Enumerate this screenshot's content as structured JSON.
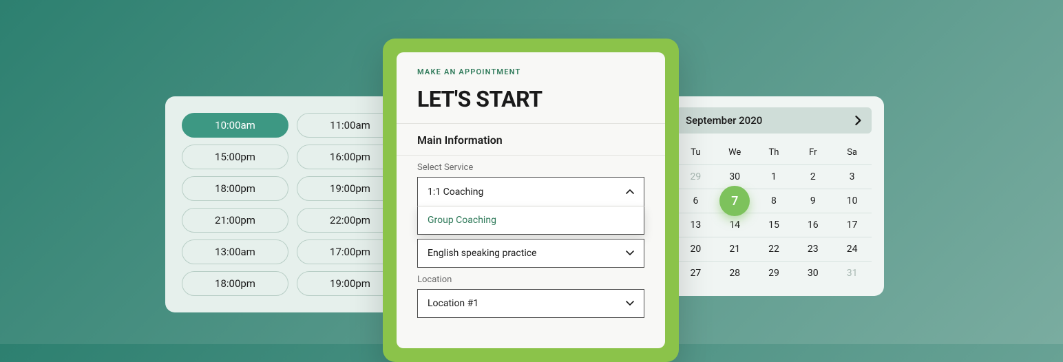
{
  "timeslots": {
    "items": [
      {
        "label": "10:00am",
        "selected": true
      },
      {
        "label": "11:00am",
        "selected": false
      },
      {
        "label": "15:00pm",
        "selected": false
      },
      {
        "label": "16:00pm",
        "selected": false
      },
      {
        "label": "18:00pm",
        "selected": false
      },
      {
        "label": "19:00pm",
        "selected": false
      },
      {
        "label": "21:00pm",
        "selected": false
      },
      {
        "label": "22:00pm",
        "selected": false
      },
      {
        "label": "13:00am",
        "selected": false
      },
      {
        "label": "17:00pm",
        "selected": false
      },
      {
        "label": "18:00pm",
        "selected": false
      },
      {
        "label": "19:00pm",
        "selected": false
      }
    ]
  },
  "calendar": {
    "month_label": "September 2020",
    "day_headers": [
      "Tu",
      "We",
      "Th",
      "Fr",
      "Sa"
    ],
    "days": [
      {
        "n": "29",
        "muted": true
      },
      {
        "n": "30"
      },
      {
        "n": "1"
      },
      {
        "n": "2"
      },
      {
        "n": "3"
      },
      {
        "n": "6"
      },
      {
        "n": "7",
        "selected": true
      },
      {
        "n": "8"
      },
      {
        "n": "9"
      },
      {
        "n": "10"
      },
      {
        "n": "13"
      },
      {
        "n": "14"
      },
      {
        "n": "15"
      },
      {
        "n": "16"
      },
      {
        "n": "17"
      },
      {
        "n": "20"
      },
      {
        "n": "21"
      },
      {
        "n": "22"
      },
      {
        "n": "23"
      },
      {
        "n": "24"
      },
      {
        "n": "27"
      },
      {
        "n": "28"
      },
      {
        "n": "29"
      },
      {
        "n": "30"
      },
      {
        "n": "31",
        "muted": true
      }
    ]
  },
  "appointment": {
    "eyebrow": "MAKE AN APPOINTMENT",
    "title": "LET'S START",
    "section": "Main Information",
    "service_label": "Select Service",
    "service_value": "1:1 Coaching",
    "service_option": "Group Coaching",
    "practice_value": "English speaking practice",
    "location_label": "Location",
    "location_value": "Location #1"
  }
}
